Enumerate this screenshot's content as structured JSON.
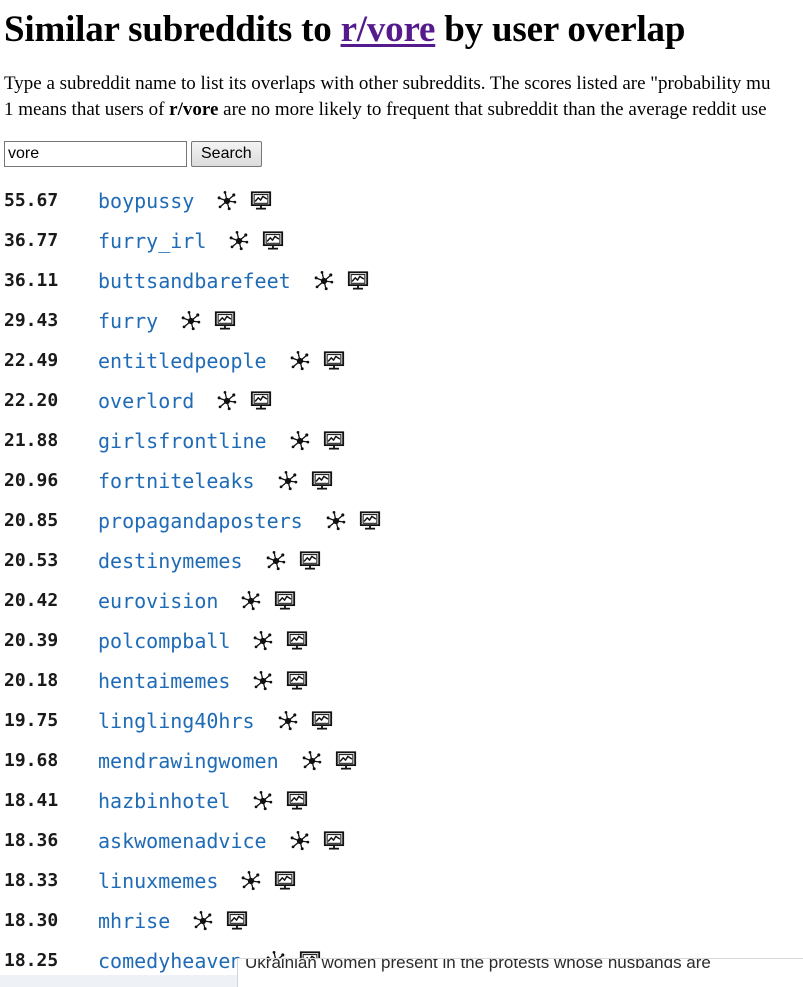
{
  "page": {
    "title_prefix": "Similar subreddits to ",
    "title_link": "r/vore",
    "title_suffix": " by user overlap",
    "link_color": "#551a8b",
    "result_link_color": "#1f6bb5"
  },
  "description": {
    "line1": "Type a subreddit name to list its overlaps with other subreddits. The scores listed are \"probability mu",
    "line2_a": "1 means that users of ",
    "line2_bold": "r/vore",
    "line2_b": " are no more likely to frequent that subreddit than the average reddit use"
  },
  "search": {
    "value": "vore",
    "placeholder": "",
    "button_label": "Search"
  },
  "icons": {
    "graph": "network-graph-icon",
    "chart": "chart-presentation-icon"
  },
  "results": [
    {
      "score": "55.67",
      "subreddit": "boypussy"
    },
    {
      "score": "36.77",
      "subreddit": "furry_irl"
    },
    {
      "score": "36.11",
      "subreddit": "buttsandbarefeet"
    },
    {
      "score": "29.43",
      "subreddit": "furry"
    },
    {
      "score": "22.49",
      "subreddit": "entitledpeople"
    },
    {
      "score": "22.20",
      "subreddit": "overlord"
    },
    {
      "score": "21.88",
      "subreddit": "girlsfrontline"
    },
    {
      "score": "20.96",
      "subreddit": "fortniteleaks"
    },
    {
      "score": "20.85",
      "subreddit": "propagandaposters"
    },
    {
      "score": "20.53",
      "subreddit": "destinymemes"
    },
    {
      "score": "20.42",
      "subreddit": "eurovision"
    },
    {
      "score": "20.39",
      "subreddit": "polcompball"
    },
    {
      "score": "20.18",
      "subreddit": "hentaimemes"
    },
    {
      "score": "19.75",
      "subreddit": "lingling40hrs"
    },
    {
      "score": "19.68",
      "subreddit": "mendrawingwomen"
    },
    {
      "score": "18.41",
      "subreddit": "hazbinhotel"
    },
    {
      "score": "18.36",
      "subreddit": "askwomenadvice"
    },
    {
      "score": "18.33",
      "subreddit": "linuxmemes"
    },
    {
      "score": "18.30",
      "subreddit": "mhrise"
    },
    {
      "score": "18.25",
      "subreddit": "comedyheaven"
    }
  ],
  "background_window": {
    "text": "Ukrainian women present in the protests  whose husbands are"
  }
}
